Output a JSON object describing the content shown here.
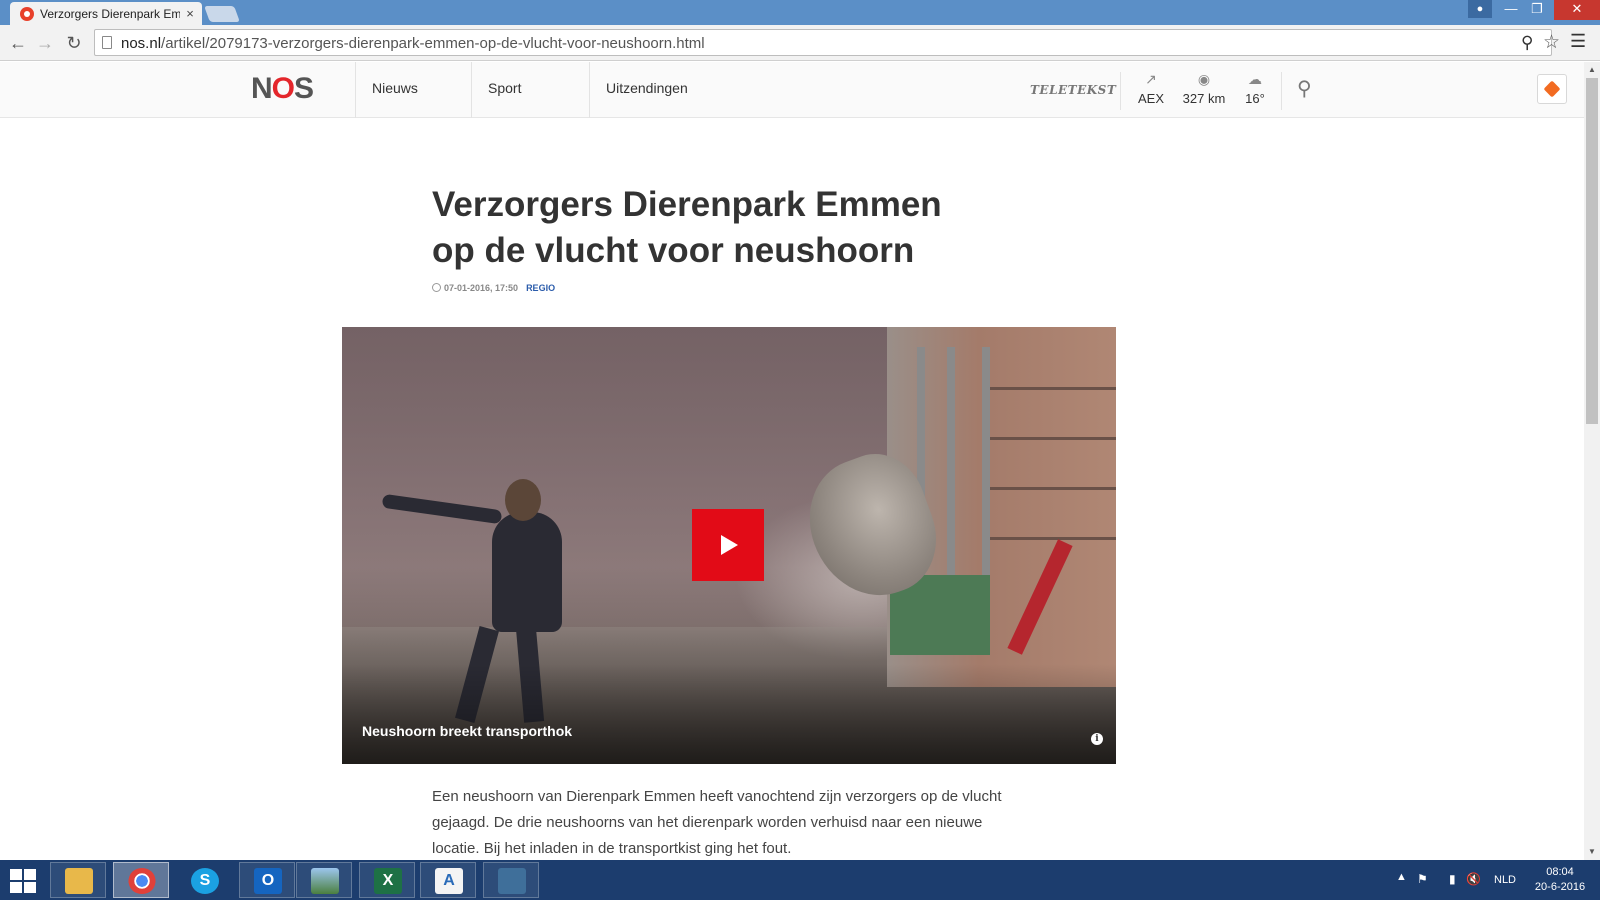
{
  "browser": {
    "tab_title": "Verzorgers Dierenpark Em",
    "tab_close": "×",
    "url_host": "nos.nl",
    "url_path": "/artikel/2079173-verzorgers-dierenpark-emmen-op-de-vlucht-voor-neushoorn.html",
    "icons": [
      "back-arrow-icon",
      "forward-arrow-icon",
      "reload-icon",
      "page-icon",
      "zoom-icon",
      "star-icon",
      "menu-icon"
    ]
  },
  "site": {
    "logo_n": "N",
    "logo_o": "O",
    "logo_s": "S",
    "nav": [
      {
        "label": "Nieuws"
      },
      {
        "label": "Sport"
      },
      {
        "label": "Uitzendingen"
      }
    ],
    "teletekst": "TELETEKST",
    "widgets": {
      "aex": "AEX",
      "traffic": "327 km",
      "temperature": "16°"
    }
  },
  "article": {
    "headline": "Verzorgers Dierenpark Emmen op de vlucht voor neushoorn",
    "date": "07-01-2016, 17:50",
    "region": "REGIO",
    "video_caption": "Neushoorn breekt transporthok",
    "lead": "Een neushoorn van Dierenpark Emmen heeft vanochtend zijn verzorgers op de vlucht gejaagd. De drie neushoorns van het dierenpark worden verhuisd naar een nieuwe locatie. Bij het inladen in de transportkist ging het fout."
  },
  "taskbar": {
    "language": "NLD",
    "time": "08:04",
    "date": "20-6-2016",
    "apps": [
      "file-explorer",
      "chrome",
      "skype",
      "outlook",
      "photos",
      "excel",
      "paint",
      "network-tool"
    ]
  },
  "colors": {
    "nos_red": "#e4262b",
    "play_red": "#e20b17",
    "region_blue": "#2b5cab",
    "taskbar": "#1c3d6e",
    "tabstrip": "#5b8fc7"
  }
}
